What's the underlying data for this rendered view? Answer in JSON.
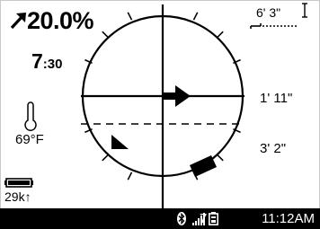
{
  "grade": {
    "value": "20.0%",
    "icon": "arrow-up-right-icon"
  },
  "timer": {
    "minutes": "7",
    "seconds": ":30"
  },
  "temperature": {
    "value": "69°F",
    "icon": "thermometer-icon"
  },
  "range": {
    "value": "29k",
    "arrow": "↑",
    "icon": "battery-level-icon",
    "battery_level_fraction": 1.0
  },
  "depth": {
    "top": "6' 3\"",
    "solid_line": "1' 11\"",
    "dashed_line": "3' 2\""
  },
  "status_bar": {
    "time": "11:12AM",
    "icons": [
      "bluetooth-icon",
      "signal-strength-icon",
      "battery-icon"
    ],
    "signal_level": "7"
  },
  "colors": {
    "foreground": "#000000",
    "background": "#ffffff",
    "status_bar_bg": "#000000",
    "status_bar_fg": "#ffffff"
  }
}
